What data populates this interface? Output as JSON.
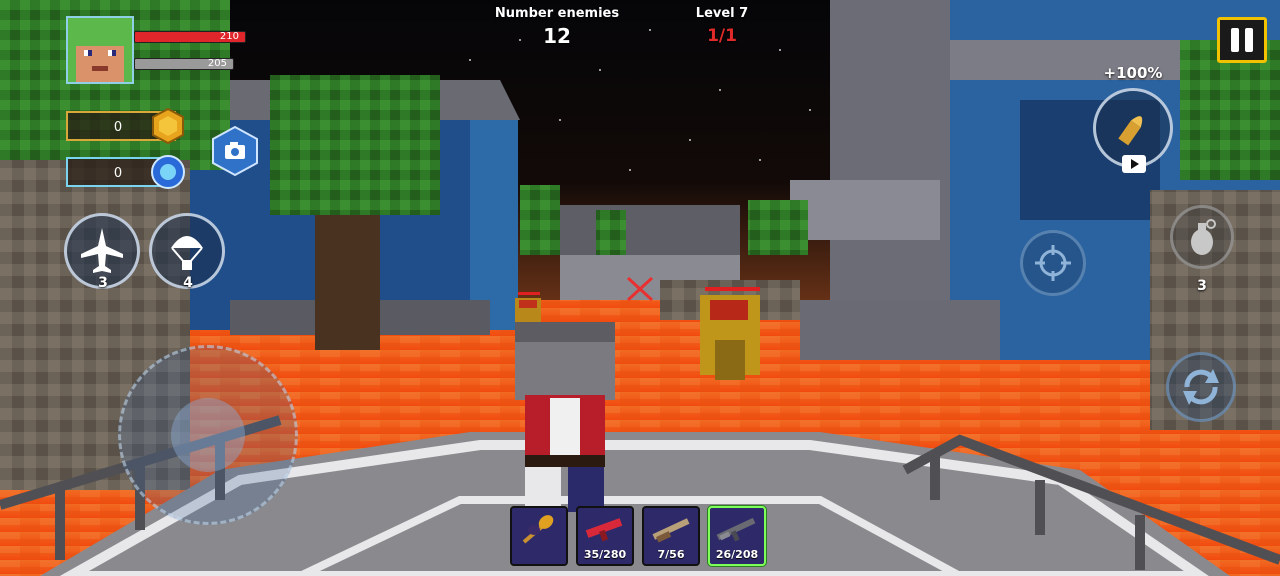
{
  "player": {
    "health": "210",
    "armor": "205"
  },
  "resources": {
    "coins": "0",
    "gems": "0"
  },
  "abilities": {
    "airstrike_count": "3",
    "airdrop_count": "4"
  },
  "enemies": {
    "label": "Number enemies",
    "count": "12"
  },
  "level": {
    "label": "Level 7",
    "wave": "1/1"
  },
  "ammo_bonus": {
    "label": "+100%"
  },
  "grenade": {
    "count": "3"
  },
  "weapons": [
    {
      "name": "axe",
      "ammo": ""
    },
    {
      "name": "red-rifle",
      "ammo": "35/280"
    },
    {
      "name": "shotgun",
      "ammo": "7/56"
    },
    {
      "name": "assault-rifle",
      "ammo": "26/208"
    }
  ],
  "colors": {
    "health": "#e0262a",
    "armor": "#9a9a9a",
    "wave": "#e02a2a",
    "selected_slot": "#7fff5a",
    "pause_border": "#f2c200"
  }
}
